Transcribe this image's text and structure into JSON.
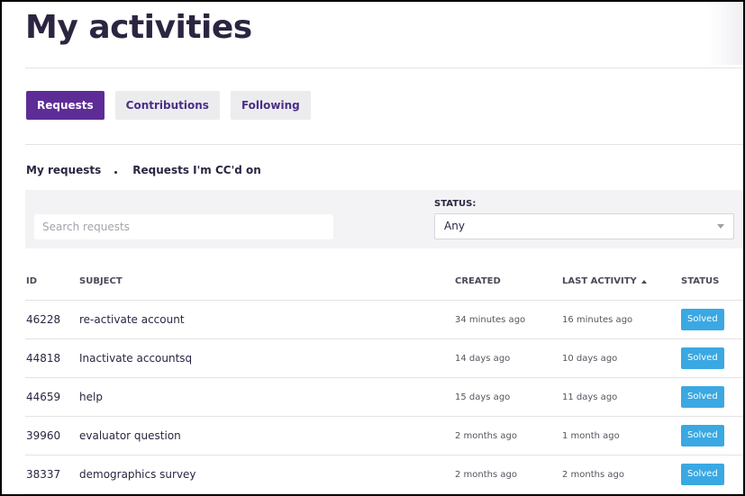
{
  "page": {
    "title": "My activities"
  },
  "tabs": [
    {
      "label": "Requests",
      "active": true
    },
    {
      "label": "Contributions",
      "active": false
    },
    {
      "label": "Following",
      "active": false
    }
  ],
  "subnav": {
    "my_requests": "My requests",
    "cc_requests": "Requests I'm CC'd on"
  },
  "filters": {
    "search_placeholder": "Search requests",
    "status_label": "STATUS:",
    "status_value": "Any"
  },
  "table": {
    "headers": {
      "id": "ID",
      "subject": "SUBJECT",
      "created": "CREATED",
      "last_activity": "LAST ACTIVITY",
      "status": "STATUS"
    },
    "rows": [
      {
        "id": "46228",
        "subject": "re-activate account",
        "created": "34 minutes ago",
        "last_activity": "16 minutes ago",
        "status": "Solved"
      },
      {
        "id": "44818",
        "subject": "Inactivate accountsq",
        "created": "14 days ago",
        "last_activity": "10 days ago",
        "status": "Solved"
      },
      {
        "id": "44659",
        "subject": "help",
        "created": "15 days ago",
        "last_activity": "11 days ago",
        "status": "Solved"
      },
      {
        "id": "39960",
        "subject": "evaluator question",
        "created": "2 months ago",
        "last_activity": "1 month ago",
        "status": "Solved"
      },
      {
        "id": "38337",
        "subject": "demographics survey",
        "created": "2 months ago",
        "last_activity": "2 months ago",
        "status": "Solved"
      }
    ]
  },
  "colors": {
    "brand": "#5e2c97",
    "solved": "#3aa8e2",
    "text": "#2c2541"
  },
  "icons": {
    "sort": "sort-ascending-icon",
    "dropdown": "chevron-down-icon"
  }
}
